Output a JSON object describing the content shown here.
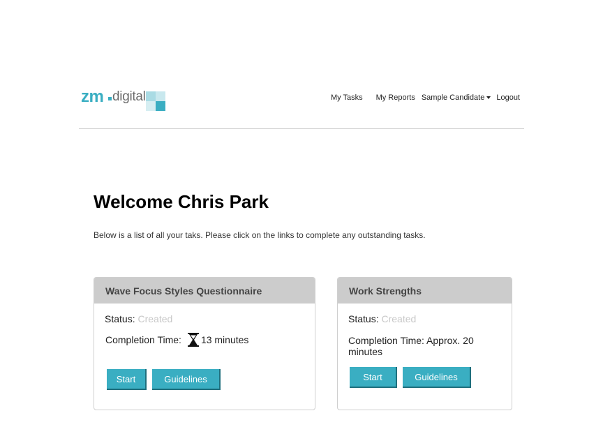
{
  "logo": {
    "brand": "zm",
    "sub": "digital"
  },
  "nav": {
    "my_tasks": "My Tasks",
    "my_reports": "My Reports",
    "candidate": "Sample Candidate",
    "logout": "Logout"
  },
  "welcome": "Welcome Chris Park",
  "intro": "Below is a list of all your taks. Please click on the links to complete any outstanding tasks.",
  "cards": [
    {
      "title": "Wave Focus Styles Questionnaire",
      "status_label": "Status:",
      "status_value": "Created",
      "time_label": "Completion Time:",
      "time_value": "13 minutes",
      "start": "Start",
      "guidelines": "Guidelines"
    },
    {
      "title": "Work Strengths",
      "status_label": "Status:",
      "status_value": "Created",
      "time_text": "Completion Time: Approx. 20 minutes",
      "start": "Start",
      "guidelines": "Guidelines"
    }
  ],
  "colors": {
    "accent": "#3aaec2",
    "header_bg": "#cccccc",
    "status_muted": "#c8c8c8"
  },
  "icons": {
    "timer": "hourglass-icon",
    "dropdown": "caret-down-icon"
  }
}
